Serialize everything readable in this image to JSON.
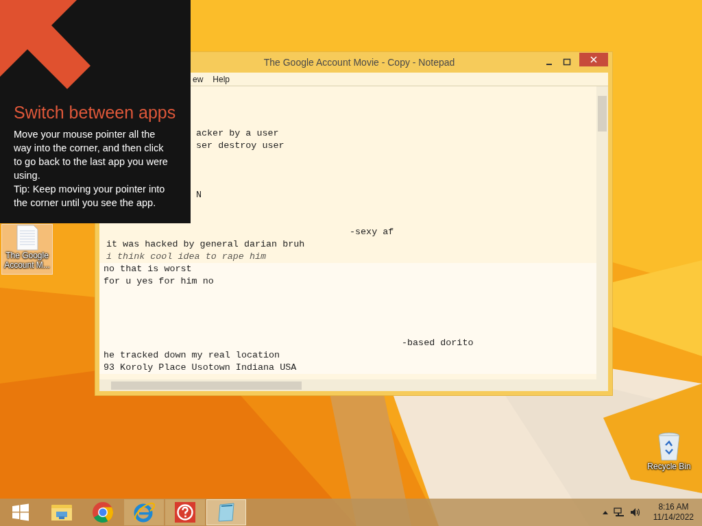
{
  "tip": {
    "title": "Switch between apps",
    "body": [
      "Move your mouse pointer all the way into the corner, and then click to go back to the last app you were using.",
      "Tip: Keep moving your pointer into the corner until you see the app."
    ]
  },
  "desktop_icons": [
    {
      "kind": "document",
      "label": "The Google Account M...",
      "selected": true
    },
    {
      "kind": "recycle-bin",
      "label": "Recycle Bin",
      "selected": false
    }
  ],
  "notepad": {
    "title": "The Google Account Movie - Copy - Notepad",
    "menu": [
      "ew",
      "Help"
    ],
    "sections": [
      {
        "lines": [
          {
            "kind": "blank"
          },
          {
            "kind": "blank"
          },
          {
            "kind": "blank"
          },
          {
            "kind": "clipped",
            "text": "acker by a user"
          },
          {
            "kind": "clipped",
            "text": "ser destroy user"
          },
          {
            "kind": "blank"
          },
          {
            "kind": "blank"
          },
          {
            "kind": "blank"
          },
          {
            "kind": "clipped",
            "text": "N"
          },
          {
            "kind": "blank"
          },
          {
            "kind": "blank"
          },
          {
            "kind": "sig",
            "text": "-sexy af"
          },
          {
            "kind": "text",
            "text": "it was hacked by general darian bruh"
          },
          {
            "kind": "garbled",
            "text": "i think cool idea to rape him"
          }
        ]
      },
      {
        "lines": [
          {
            "kind": "text",
            "text": "no that is worst"
          },
          {
            "kind": "text",
            "text": "for u yes for him no"
          },
          {
            "kind": "blank"
          },
          {
            "kind": "blank"
          },
          {
            "kind": "blank"
          },
          {
            "kind": "blank"
          },
          {
            "kind": "sig",
            "text": "-based dorito"
          },
          {
            "kind": "text",
            "text": "he tracked down my real location"
          },
          {
            "kind": "text",
            "text": "93 Koroly Place Usotown Indiana USA"
          }
        ]
      }
    ]
  },
  "taskbar": {
    "apps": [
      {
        "kind": "start",
        "open": false,
        "selected": false
      },
      {
        "kind": "explorer",
        "open": false,
        "selected": false
      },
      {
        "kind": "chrome",
        "open": false,
        "selected": false
      },
      {
        "kind": "ie",
        "open": true,
        "selected": false
      },
      {
        "kind": "help",
        "open": true,
        "selected": false
      },
      {
        "kind": "notepad",
        "open": true,
        "selected": true
      }
    ],
    "clock": {
      "time": "8:16 AM",
      "date": "11/14/2022"
    }
  }
}
